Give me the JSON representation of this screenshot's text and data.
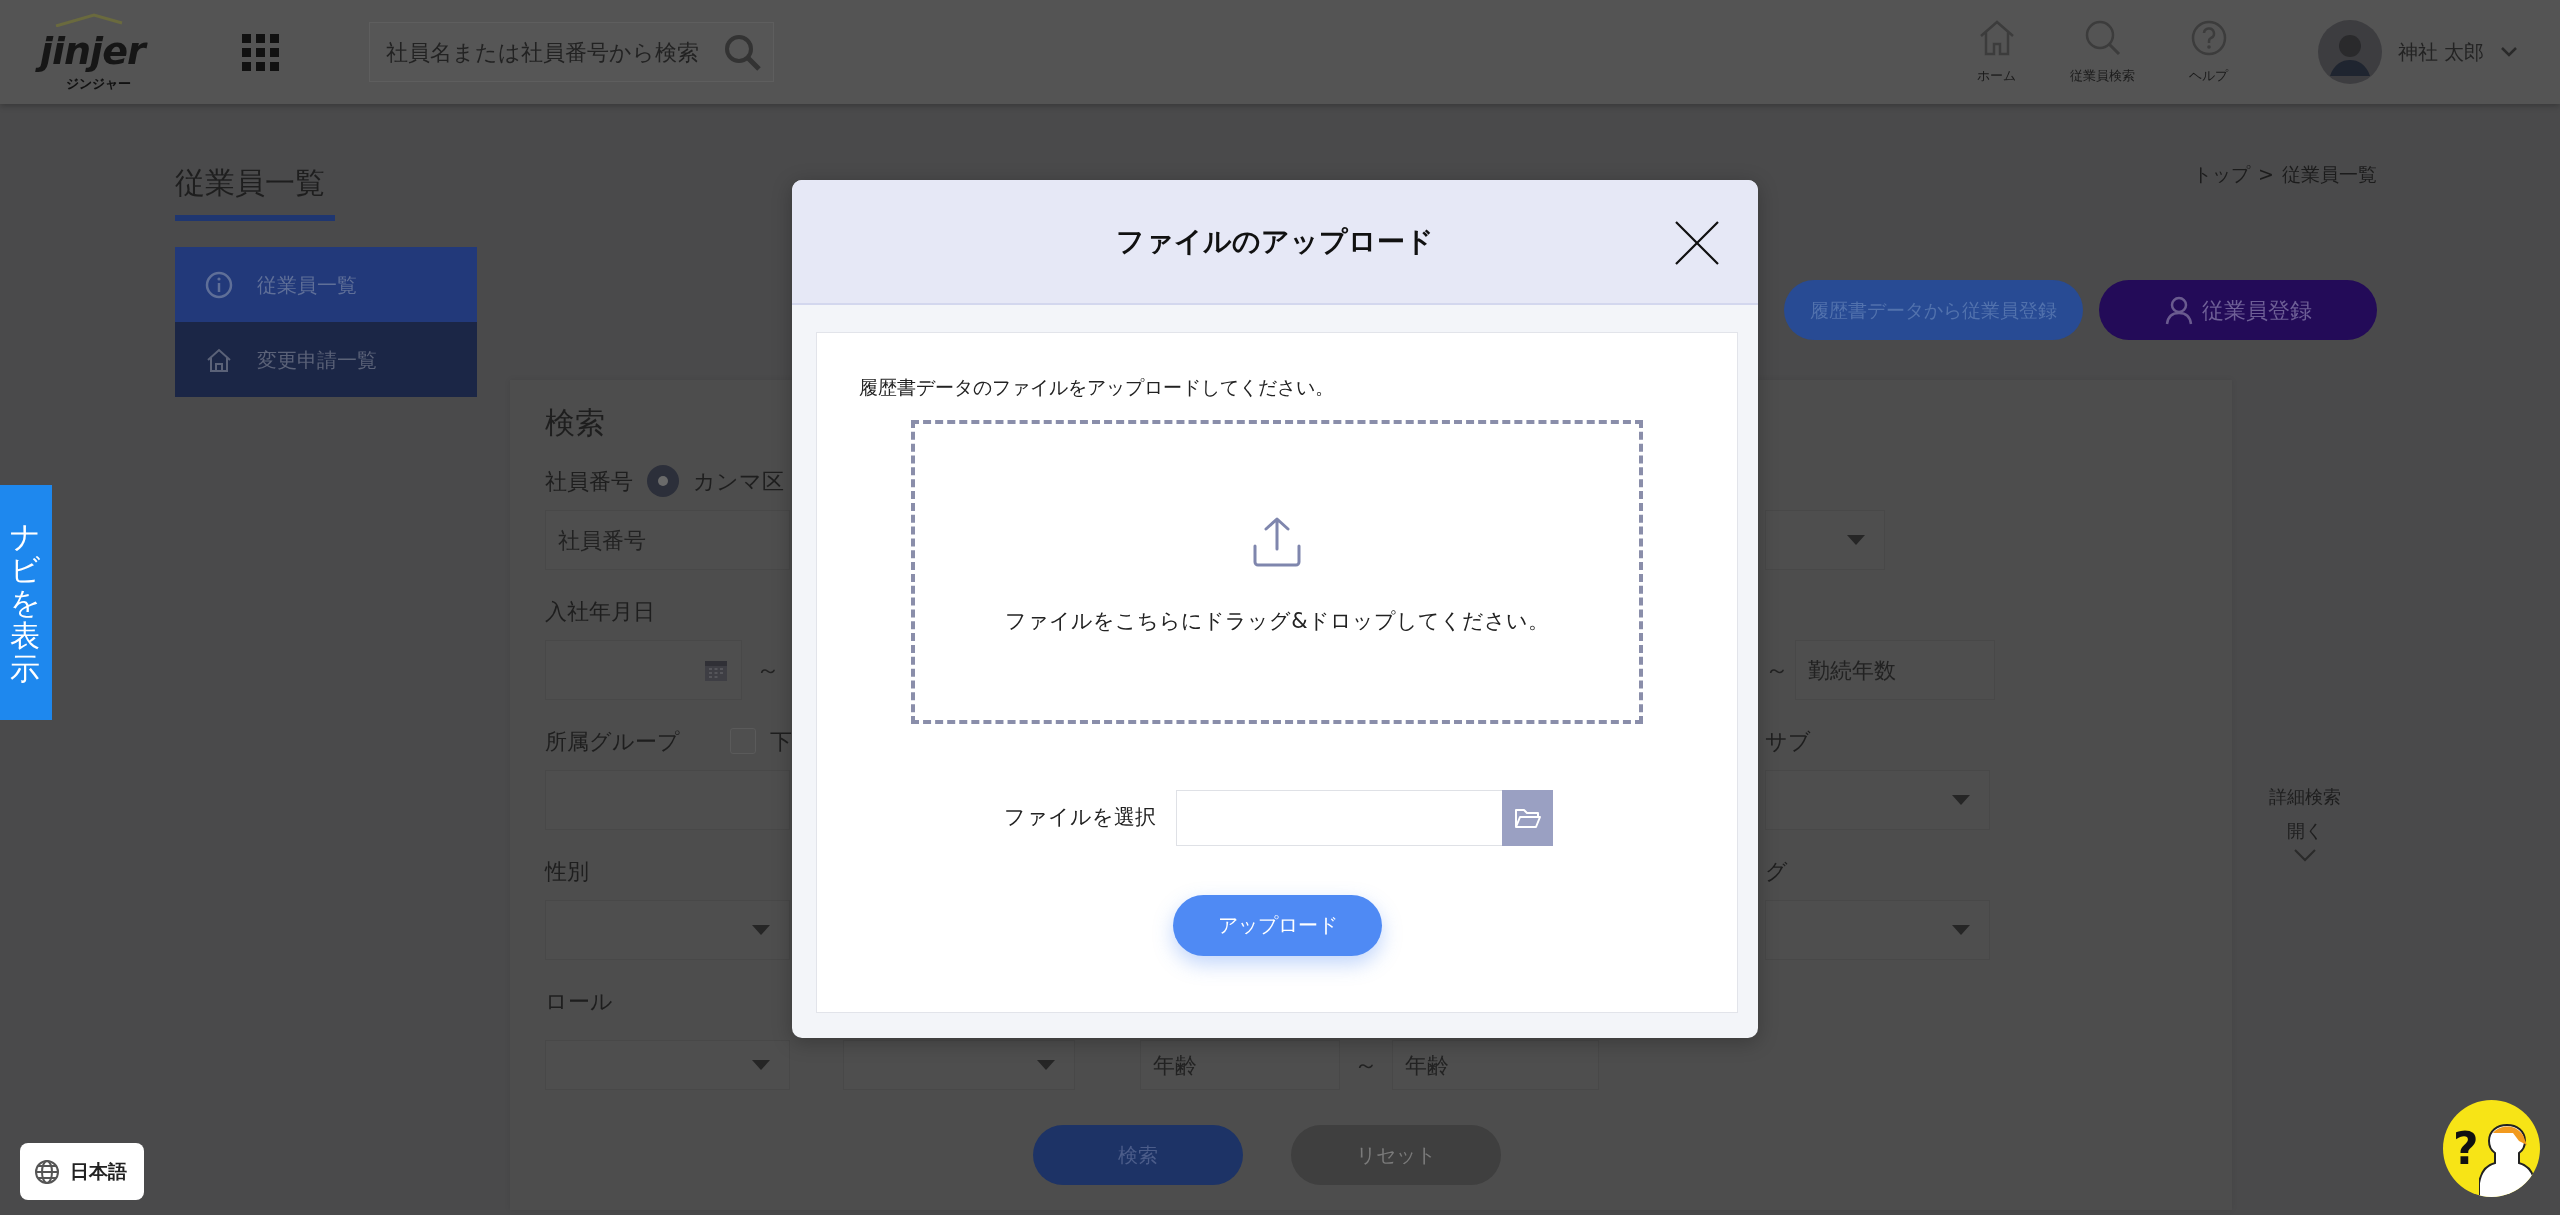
{
  "header": {
    "logo": "jinjer",
    "logo_sub": "ジンジャー",
    "search": {
      "placeholder": "社員名または社員番号から検索"
    },
    "nav": [
      {
        "label": "ホーム",
        "kind": "home"
      },
      {
        "label": "従業員検索",
        "kind": "search"
      },
      {
        "label": "ヘルプ",
        "kind": "help"
      }
    ],
    "user": {
      "name": "神社 太郎"
    }
  },
  "page": {
    "title": "従業員一覧",
    "breadcrumb": [
      "トップ",
      "従業員一覧"
    ],
    "breadcrumb_separator": ">"
  },
  "side_menu": [
    {
      "label": "従業員一覧",
      "kind": "info",
      "selected": true
    },
    {
      "label": "変更申請一覧",
      "kind": "house",
      "selected": false
    }
  ],
  "actions": [
    {
      "label": "履歴書データから従業員登録",
      "kind": "import"
    },
    {
      "label": "従業員登録",
      "kind": "register"
    }
  ],
  "search_form": {
    "title": "検索",
    "employee_no": {
      "label": "社員番号",
      "radio": {
        "label": "カンマ区",
        "selected": true
      },
      "placeholder": "社員番号"
    },
    "hire_date": {
      "label": "入社年月日",
      "separator": "～"
    },
    "tenure": {
      "separator": "～",
      "placeholder": "勤続年数"
    },
    "group": {
      "label": "所属グループ",
      "checkbox": {
        "label": "下",
        "checked": false
      }
    },
    "sub_label": "サブ",
    "gender": {
      "label": "性別"
    },
    "tag_label": "グ",
    "role": {
      "label": "ロール"
    },
    "age": {
      "from_placeholder": "年齢",
      "separator": "～",
      "to_placeholder": "年齢"
    },
    "buttons": [
      {
        "label": "検索",
        "kind": "primary"
      },
      {
        "label": "リセット",
        "kind": "secondary"
      }
    ]
  },
  "advanced_search": {
    "label": "詳細検索",
    "toggle": "開く",
    "expanded": false
  },
  "nav_tab": "ナビを表示",
  "language": "日本語",
  "help_widget": {
    "mark": "?"
  },
  "modal": {
    "title": "ファイルのアップロード",
    "description": "履歴書データのファイルをアップロードしてください。",
    "dropzone_text": "ファイルをこちらにドラッグ&ドロップしてください。",
    "file_label": "ファイルを選択",
    "upload_button": "アップロード"
  }
}
